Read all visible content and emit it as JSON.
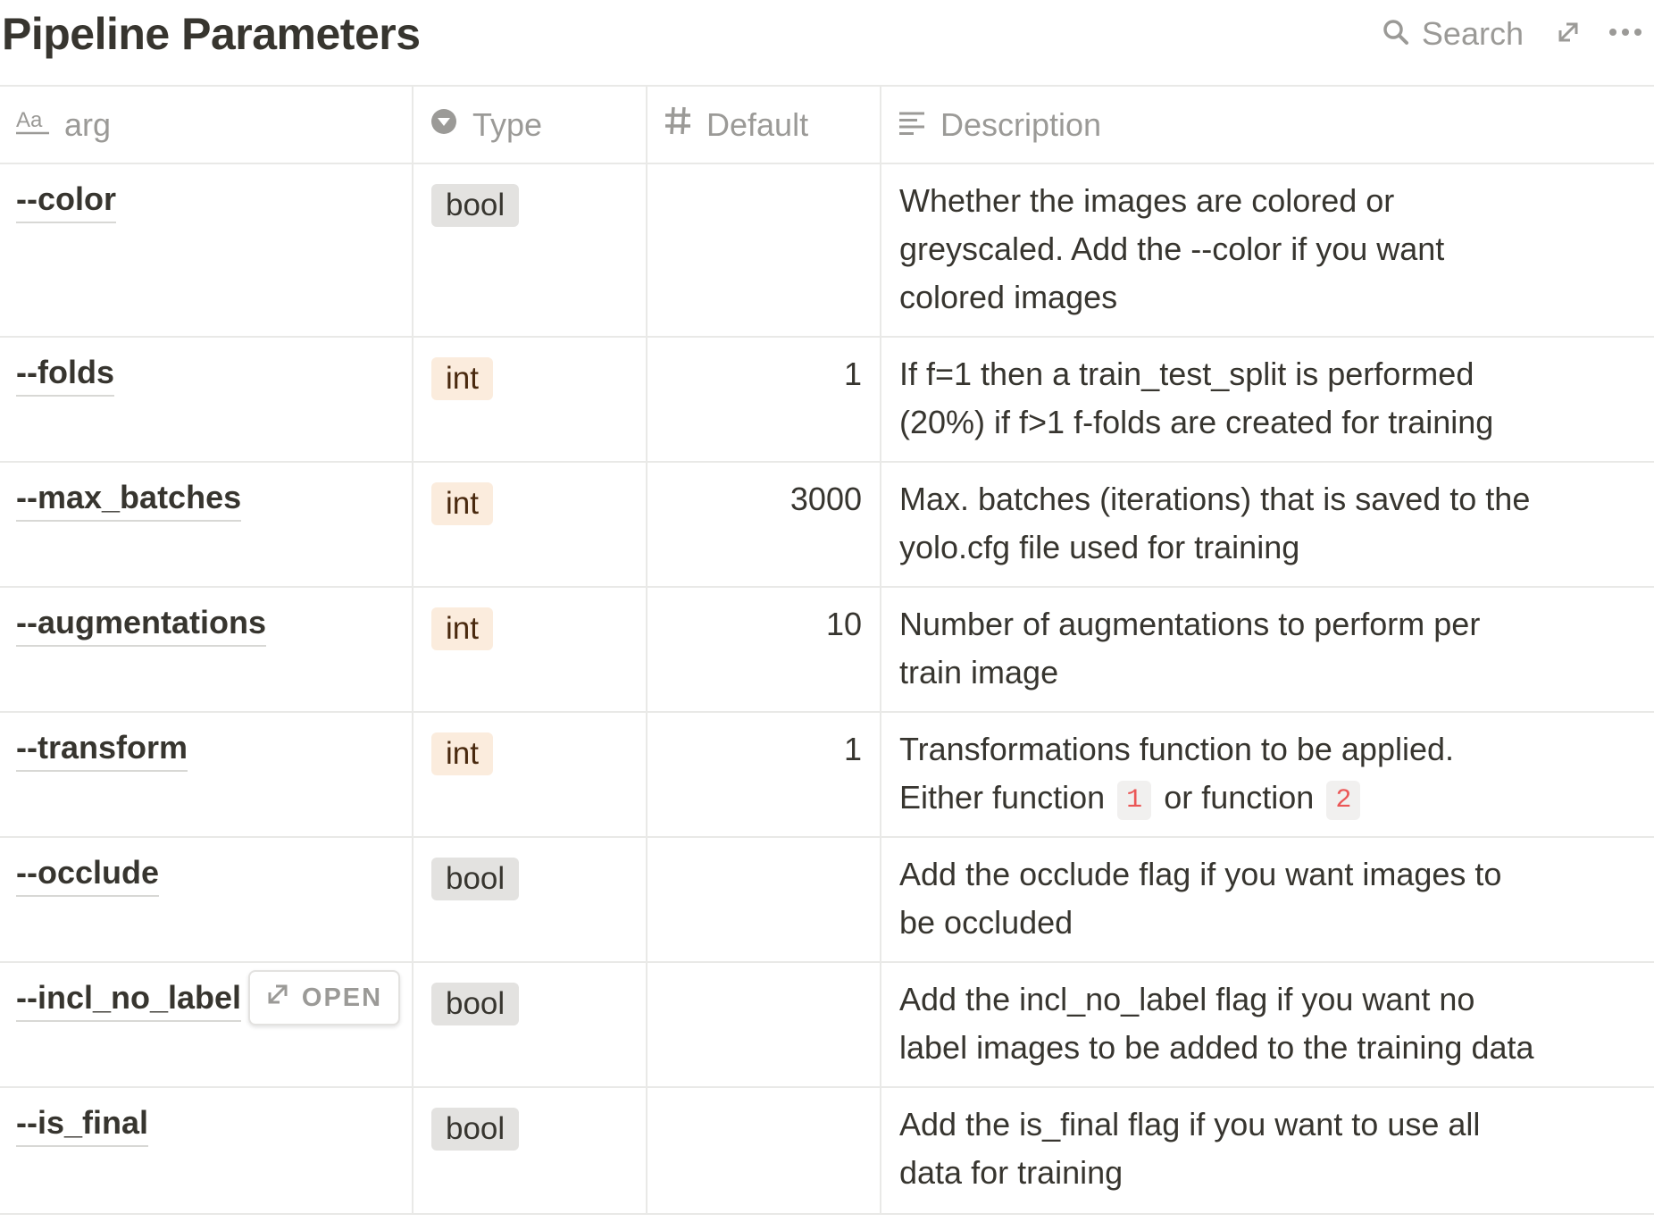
{
  "header": {
    "title": "Pipeline Parameters",
    "search_label": "Search"
  },
  "columns": {
    "arg": {
      "label": "arg",
      "icon": "text-type-icon"
    },
    "type": {
      "label": "Type",
      "icon": "select-icon"
    },
    "default": {
      "label": "Default",
      "icon": "number-icon"
    },
    "description": {
      "label": "Description",
      "icon": "text-lines-icon"
    }
  },
  "rows": [
    {
      "arg": "--color",
      "type": "bool",
      "default": "",
      "desc": [
        "Whether the images are colored or",
        "greyscaled. Add the --color if you want",
        "colored images"
      ]
    },
    {
      "arg": "--folds",
      "type": "int",
      "default": "1",
      "desc": [
        "If f=1 then a train_test_split is performed",
        "(20%) if f>1 f-folds are created for training"
      ]
    },
    {
      "arg": "--max_batches",
      "type": "int",
      "default": "3000",
      "desc": [
        "Max. batches (iterations) that is saved to the",
        "yolo.cfg file used for training"
      ]
    },
    {
      "arg": "--augmentations",
      "type": "int",
      "default": "10",
      "desc": [
        "Number of augmentations to perform per",
        "train image"
      ]
    },
    {
      "arg": "--transform",
      "type": "int",
      "default": "1",
      "desc": [
        "Transformations function to be applied.",
        "Either function",
        "1",
        "or function",
        "2"
      ]
    },
    {
      "arg": "--occlude",
      "type": "bool",
      "default": "",
      "desc": [
        "Add the occlude flag if you want images to",
        "be occluded"
      ]
    },
    {
      "arg": "--incl_no_label",
      "type": "bool",
      "default": "",
      "desc": [
        "Add the incl_no_label flag if you want no",
        "label images to be added to the training data"
      ],
      "open_label": "OPEN"
    },
    {
      "arg": "--is_final",
      "type": "bool",
      "default": "",
      "desc": [
        "Add the is_final flag if you want to use all",
        "data for training"
      ]
    }
  ],
  "colors": {
    "text": "#37352f",
    "muted": "#9b9a97",
    "border": "#e9e9e7",
    "tag_bool": "#e3e2e0",
    "tag_int": "#fbecdd",
    "code_red": "#eb5757"
  }
}
